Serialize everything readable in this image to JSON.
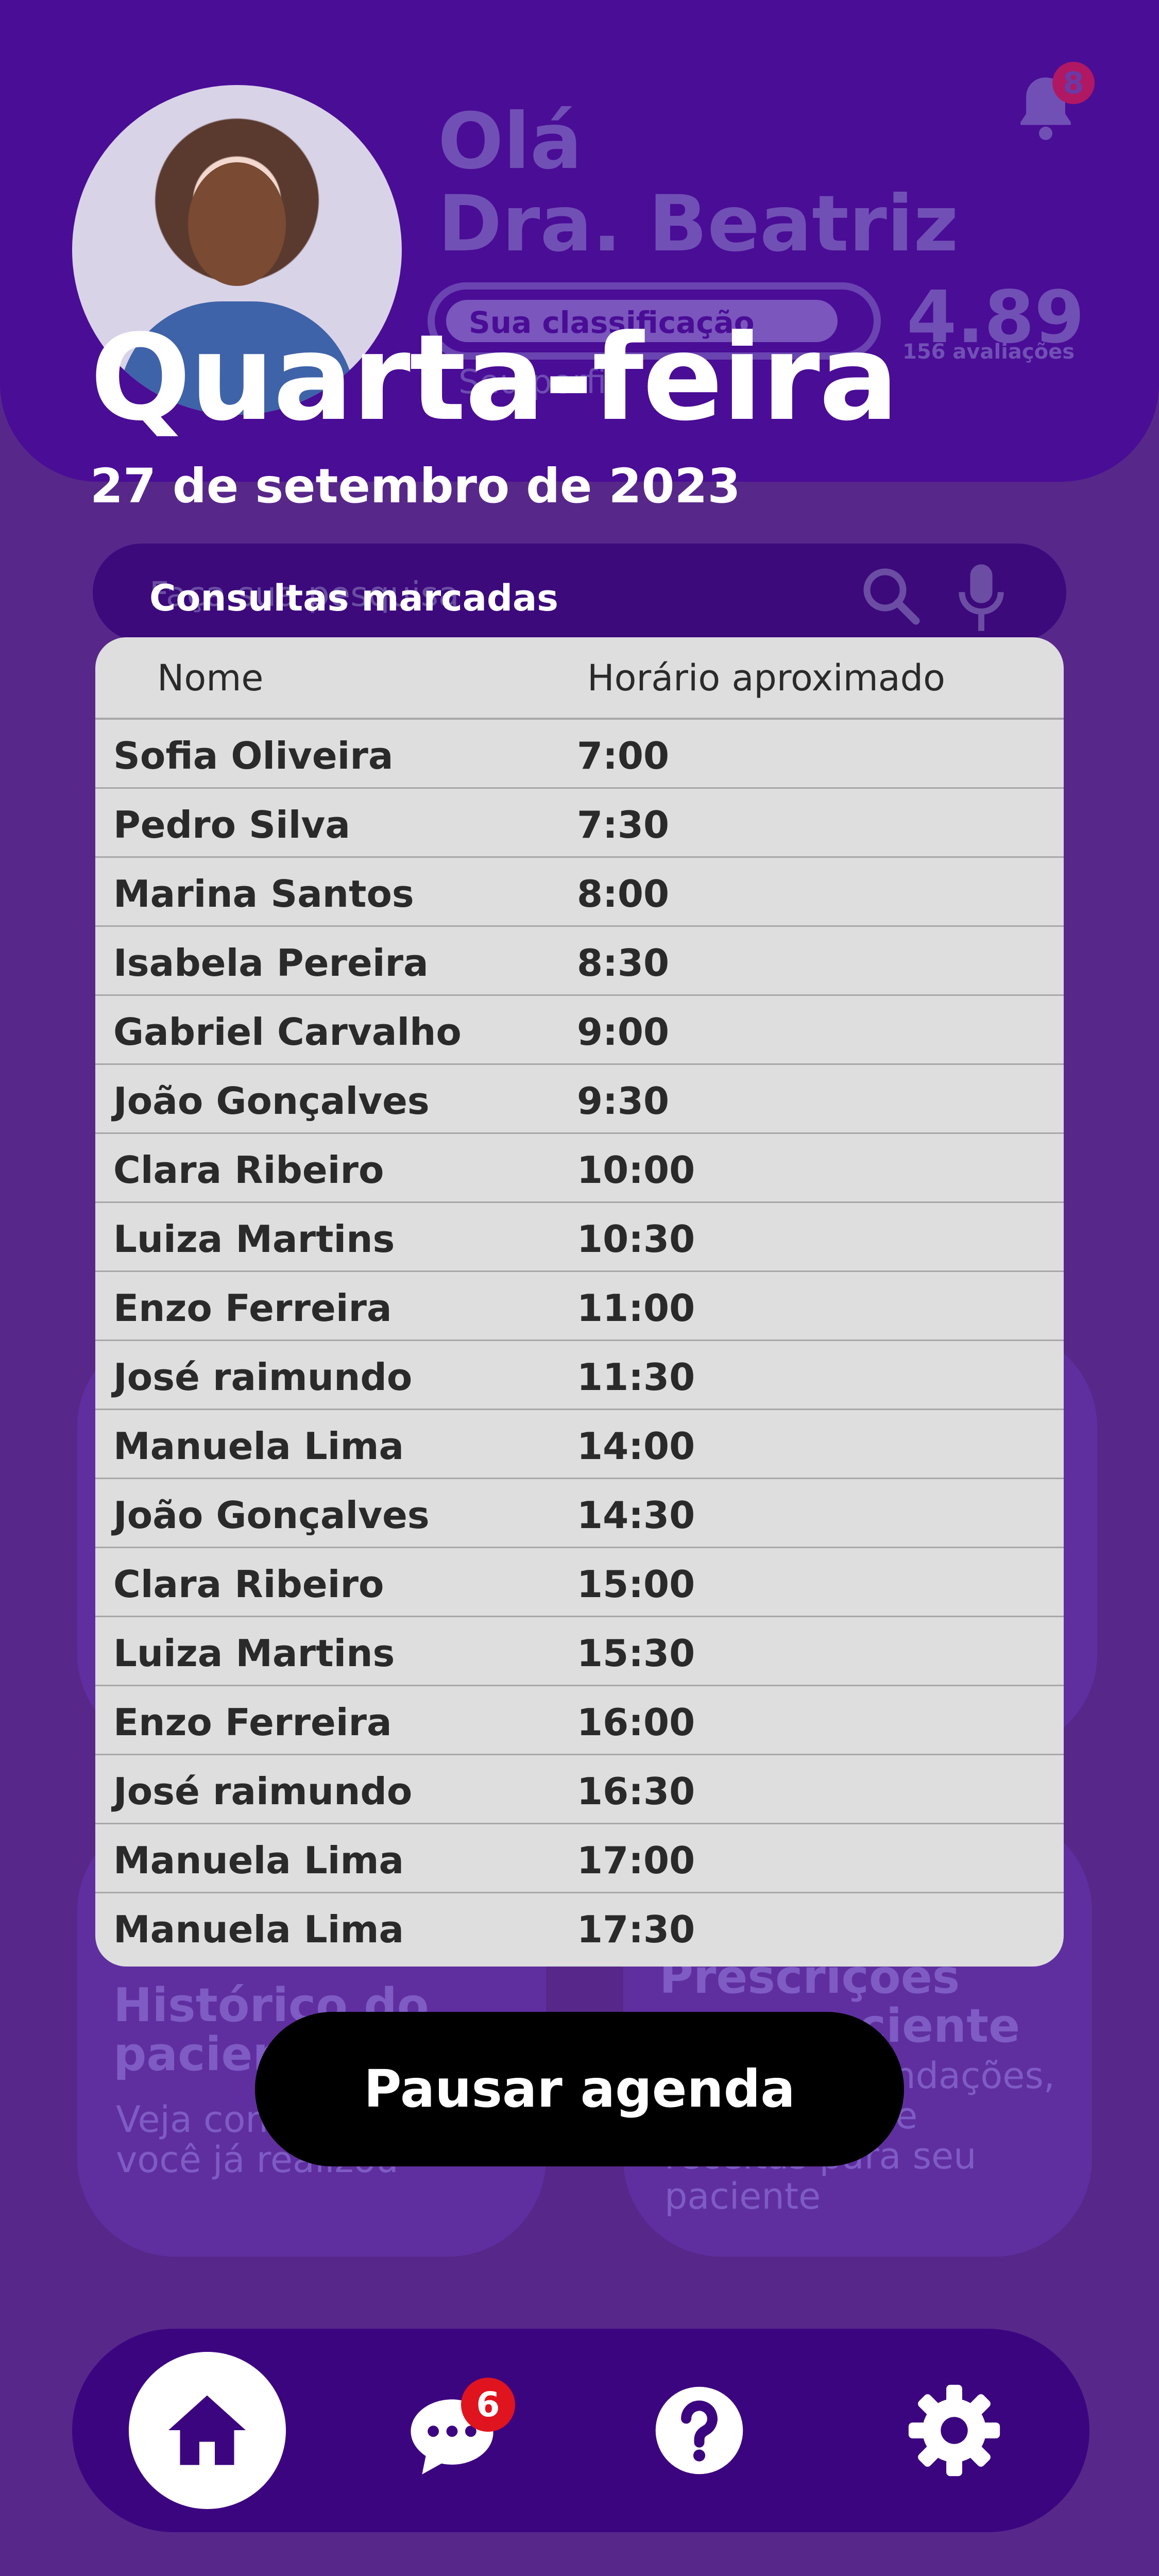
{
  "header": {
    "greeting_line1": "Olá",
    "greeting_line2": "Dra. Beatriz",
    "rating_label": "Sua classificação",
    "subtitle": "Seu perfil",
    "score": "4.89",
    "reviews": "156 avaliações",
    "notification_count": "8"
  },
  "search": {
    "placeholder": "Faça sua pesquisa"
  },
  "schedule": {
    "day": "Quarta-feira",
    "date": "27 de setembro de 2023",
    "section_label": "Consultas marcadas",
    "columns": [
      "Nome",
      "Horário aproximado"
    ],
    "rows": [
      {
        "name": "Sofia Oliveira",
        "time": "7:00"
      },
      {
        "name": "Pedro Silva",
        "time": "7:30"
      },
      {
        "name": "Marina Santos",
        "time": "8:00"
      },
      {
        "name": "Isabela Pereira",
        "time": "8:30"
      },
      {
        "name": "Gabriel Carvalho",
        "time": "9:00"
      },
      {
        "name": "João Gonçalves",
        "time": "9:30"
      },
      {
        "name": "Clara Ribeiro",
        "time": "10:00"
      },
      {
        "name": "Luiza Martins",
        "time": "10:30"
      },
      {
        "name": "Enzo Ferreira",
        "time": "11:00"
      },
      {
        "name": "José raimundo",
        "time": "11:30"
      },
      {
        "name": "Manuela Lima",
        "time": "14:00"
      },
      {
        "name": "João Gonçalves",
        "time": "14:30"
      },
      {
        "name": "Clara Ribeiro",
        "time": "15:00"
      },
      {
        "name": "Luiza Martins",
        "time": "15:30"
      },
      {
        "name": "Enzo Ferreira",
        "time": "16:00"
      },
      {
        "name": "José raimundo",
        "time": "16:30"
      },
      {
        "name": "Manuela Lima",
        "time": "17:00"
      },
      {
        "name": "Manuela Lima",
        "time": "17:30"
      }
    ],
    "pause_button": "Pausar agenda"
  },
  "cards": {
    "history_title": "Histórico do paciente",
    "history_text": "Veja consultas que você já realizou",
    "prescriptions_title": "Prescrições para paciente",
    "prescriptions_text": "Faça recomendações, exames e crie receitas para seu paciente"
  },
  "nav": {
    "chat_badge": "6",
    "items": [
      "home-icon",
      "chat-icon",
      "help-icon",
      "settings-icon"
    ]
  },
  "colors": {
    "header_bg": "#4a0d96",
    "page_bg": "#57288a",
    "nav_bg": "#3c0580",
    "table_bg": "#dedede",
    "badge_red": "#e0141e"
  }
}
